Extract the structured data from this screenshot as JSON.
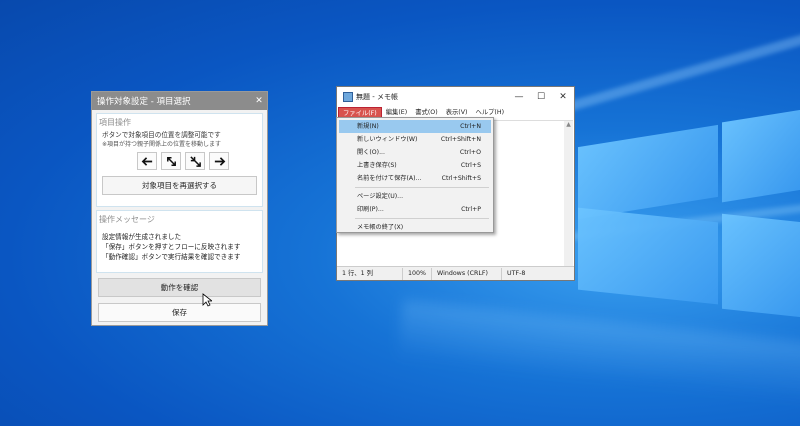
{
  "app": {
    "title": "操作対象設定 - 項目選択",
    "close_glyph": "✕",
    "section1": {
      "heading": "項目操作",
      "desc": "ボタンで対象項目の位置を調整可能です",
      "note": "※項目が持つ親子関係上の位置を移動します",
      "arrow_icons": [
        "arrow-left-icon",
        "arrow-expand-icon",
        "arrow-collapse-icon",
        "arrow-right-icon"
      ],
      "reselect_label": "対象項目を再選択する"
    },
    "section2": {
      "heading": "操作メッセージ",
      "lines": [
        "設定情報が生成されました",
        "「保存」ボタンを押すとフローに反映されます",
        "「動作確認」ボタンで実行結果を確認できます"
      ]
    },
    "verify_label": "動作を確認",
    "save_label": "保存"
  },
  "notepad": {
    "title": "無題 - メモ帳",
    "menu": [
      "ファイル(F)",
      "編集(E)",
      "書式(O)",
      "表示(V)",
      "ヘルプ(H)"
    ],
    "window_buttons": {
      "minimize": "—",
      "maximize": "☐",
      "close": "✕"
    },
    "status": {
      "position": "1 行、1 列",
      "zoom": "100%",
      "eol": "Windows (CRLF)",
      "encoding": "UTF-8"
    },
    "file_menu": {
      "items": [
        {
          "label": "新規(N)",
          "shortcut": "Ctrl+N"
        },
        {
          "label": "新しいウィンドウ(W)",
          "shortcut": "Ctrl+Shift+N"
        },
        {
          "label": "開く(O)...",
          "shortcut": "Ctrl+O"
        },
        {
          "label": "上書き保存(S)",
          "shortcut": "Ctrl+S"
        },
        {
          "label": "名前を付けて保存(A)...",
          "shortcut": "Ctrl+Shift+S"
        },
        {
          "label": "ページ設定(U)...",
          "shortcut": ""
        },
        {
          "label": "印刷(P)...",
          "shortcut": "Ctrl+P"
        },
        {
          "label": "メモ帳の終了(X)",
          "shortcut": ""
        }
      ]
    }
  },
  "colors": {
    "accent_menu": "#d8534e",
    "highlight": "#99c9ef",
    "desktop": "#0a56c2"
  }
}
